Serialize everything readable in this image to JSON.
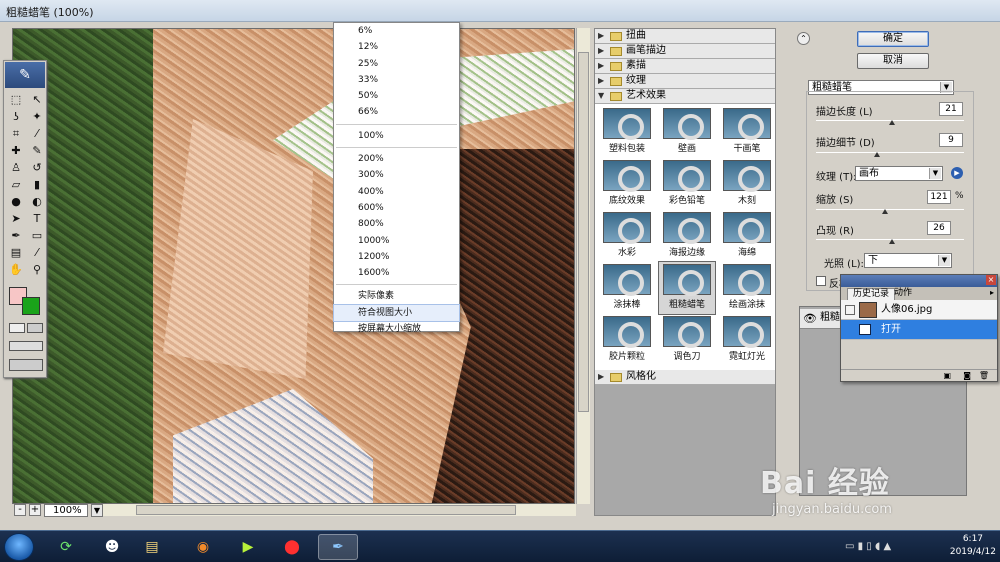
{
  "window": {
    "title": "粗糙蜡笔 (100%)"
  },
  "zoom": {
    "value": "100%",
    "minus": "-",
    "plus": "+"
  },
  "zoom_menu": {
    "group1": [
      "6%",
      "12%",
      "25%",
      "33%",
      "50%",
      "66%"
    ],
    "group2": [
      "100%"
    ],
    "group3": [
      "200%",
      "300%",
      "400%",
      "600%",
      "800%",
      "1000%",
      "1200%",
      "1600%"
    ],
    "group4": [
      "实际像素",
      "符合视图大小",
      "按屏幕大小缩放"
    ],
    "highlighted": "符合视图大小"
  },
  "gallery": {
    "categories_top": [
      "扭曲",
      "画笔描边",
      "素描",
      "纹理"
    ],
    "open_category": "艺术效果",
    "filters": [
      "塑料包装",
      "壁画",
      "干画笔",
      "底纹效果",
      "彩色铅笔",
      "木刻",
      "水彩",
      "海报边缘",
      "海绵",
      "涂抹棒",
      "粗糙蜡笔",
      "绘画涂抹",
      "胶片颗粒",
      "调色刀",
      "霓虹灯光"
    ],
    "selected_filter": "粗糙蜡笔",
    "categories_bottom": [
      "风格化"
    ]
  },
  "buttons": {
    "ok": "确定",
    "cancel": "取消"
  },
  "settings": {
    "filter_select": "粗糙蜡笔",
    "stroke_length_label": "描边长度 (L)",
    "stroke_length": "21",
    "stroke_detail_label": "描边细节 (D)",
    "stroke_detail": "9",
    "texture_label": "纹理 (T):",
    "texture_value": "画布",
    "scale_label": "缩放 (S)",
    "scale_value": "121",
    "scale_unit": "%",
    "relief_label": "凸现 (R)",
    "relief_value": "26",
    "light_label": "光照 (L):",
    "light_value": "下",
    "invert_label": "反相"
  },
  "layers": {
    "row_label": "粗糙蜡笔"
  },
  "history": {
    "tab_history": "历史记录",
    "tab_actions": "动作",
    "snapshot": "人像06.jpg",
    "step": "打开"
  },
  "taskbar": {
    "time": "6:17",
    "date": "2019/4/12"
  },
  "watermark": {
    "brand": "Bai 经验",
    "url": "jingyan.baidu.com"
  },
  "colors": {
    "foreground": "#f7c6c6",
    "background": "#1aa31a",
    "selection": "#2f7fe0"
  }
}
